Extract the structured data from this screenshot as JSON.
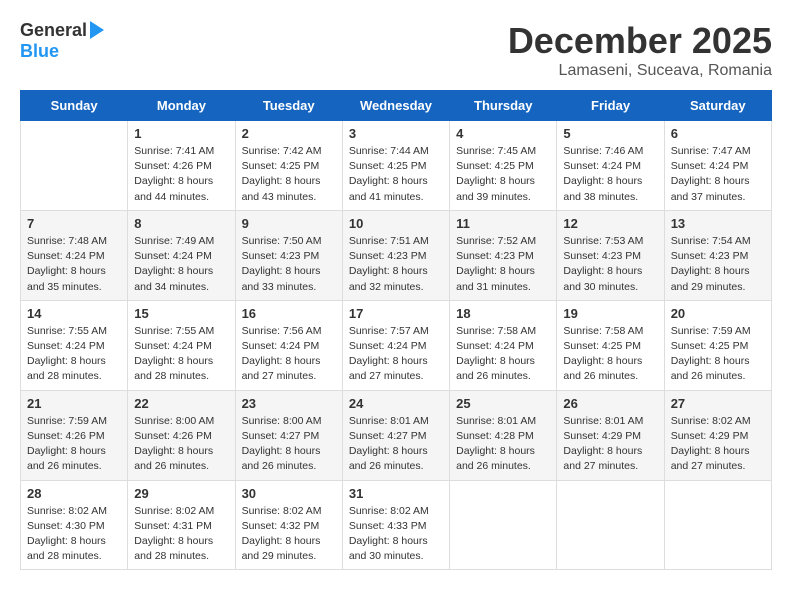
{
  "header": {
    "logo_general": "General",
    "logo_blue": "Blue",
    "month": "December 2025",
    "location": "Lamaseni, Suceava, Romania"
  },
  "days_of_week": [
    "Sunday",
    "Monday",
    "Tuesday",
    "Wednesday",
    "Thursday",
    "Friday",
    "Saturday"
  ],
  "weeks": [
    [
      {
        "day": null,
        "sunrise": null,
        "sunset": null,
        "daylight": null
      },
      {
        "day": "1",
        "sunrise": "7:41 AM",
        "sunset": "4:26 PM",
        "daylight": "8 hours and 44 minutes."
      },
      {
        "day": "2",
        "sunrise": "7:42 AM",
        "sunset": "4:25 PM",
        "daylight": "8 hours and 43 minutes."
      },
      {
        "day": "3",
        "sunrise": "7:44 AM",
        "sunset": "4:25 PM",
        "daylight": "8 hours and 41 minutes."
      },
      {
        "day": "4",
        "sunrise": "7:45 AM",
        "sunset": "4:25 PM",
        "daylight": "8 hours and 39 minutes."
      },
      {
        "day": "5",
        "sunrise": "7:46 AM",
        "sunset": "4:24 PM",
        "daylight": "8 hours and 38 minutes."
      },
      {
        "day": "6",
        "sunrise": "7:47 AM",
        "sunset": "4:24 PM",
        "daylight": "8 hours and 37 minutes."
      }
    ],
    [
      {
        "day": "7",
        "sunrise": "7:48 AM",
        "sunset": "4:24 PM",
        "daylight": "8 hours and 35 minutes."
      },
      {
        "day": "8",
        "sunrise": "7:49 AM",
        "sunset": "4:24 PM",
        "daylight": "8 hours and 34 minutes."
      },
      {
        "day": "9",
        "sunrise": "7:50 AM",
        "sunset": "4:23 PM",
        "daylight": "8 hours and 33 minutes."
      },
      {
        "day": "10",
        "sunrise": "7:51 AM",
        "sunset": "4:23 PM",
        "daylight": "8 hours and 32 minutes."
      },
      {
        "day": "11",
        "sunrise": "7:52 AM",
        "sunset": "4:23 PM",
        "daylight": "8 hours and 31 minutes."
      },
      {
        "day": "12",
        "sunrise": "7:53 AM",
        "sunset": "4:23 PM",
        "daylight": "8 hours and 30 minutes."
      },
      {
        "day": "13",
        "sunrise": "7:54 AM",
        "sunset": "4:23 PM",
        "daylight": "8 hours and 29 minutes."
      }
    ],
    [
      {
        "day": "14",
        "sunrise": "7:55 AM",
        "sunset": "4:24 PM",
        "daylight": "8 hours and 28 minutes."
      },
      {
        "day": "15",
        "sunrise": "7:55 AM",
        "sunset": "4:24 PM",
        "daylight": "8 hours and 28 minutes."
      },
      {
        "day": "16",
        "sunrise": "7:56 AM",
        "sunset": "4:24 PM",
        "daylight": "8 hours and 27 minutes."
      },
      {
        "day": "17",
        "sunrise": "7:57 AM",
        "sunset": "4:24 PM",
        "daylight": "8 hours and 27 minutes."
      },
      {
        "day": "18",
        "sunrise": "7:58 AM",
        "sunset": "4:24 PM",
        "daylight": "8 hours and 26 minutes."
      },
      {
        "day": "19",
        "sunrise": "7:58 AM",
        "sunset": "4:25 PM",
        "daylight": "8 hours and 26 minutes."
      },
      {
        "day": "20",
        "sunrise": "7:59 AM",
        "sunset": "4:25 PM",
        "daylight": "8 hours and 26 minutes."
      }
    ],
    [
      {
        "day": "21",
        "sunrise": "7:59 AM",
        "sunset": "4:26 PM",
        "daylight": "8 hours and 26 minutes."
      },
      {
        "day": "22",
        "sunrise": "8:00 AM",
        "sunset": "4:26 PM",
        "daylight": "8 hours and 26 minutes."
      },
      {
        "day": "23",
        "sunrise": "8:00 AM",
        "sunset": "4:27 PM",
        "daylight": "8 hours and 26 minutes."
      },
      {
        "day": "24",
        "sunrise": "8:01 AM",
        "sunset": "4:27 PM",
        "daylight": "8 hours and 26 minutes."
      },
      {
        "day": "25",
        "sunrise": "8:01 AM",
        "sunset": "4:28 PM",
        "daylight": "8 hours and 26 minutes."
      },
      {
        "day": "26",
        "sunrise": "8:01 AM",
        "sunset": "4:29 PM",
        "daylight": "8 hours and 27 minutes."
      },
      {
        "day": "27",
        "sunrise": "8:02 AM",
        "sunset": "4:29 PM",
        "daylight": "8 hours and 27 minutes."
      }
    ],
    [
      {
        "day": "28",
        "sunrise": "8:02 AM",
        "sunset": "4:30 PM",
        "daylight": "8 hours and 28 minutes."
      },
      {
        "day": "29",
        "sunrise": "8:02 AM",
        "sunset": "4:31 PM",
        "daylight": "8 hours and 28 minutes."
      },
      {
        "day": "30",
        "sunrise": "8:02 AM",
        "sunset": "4:32 PM",
        "daylight": "8 hours and 29 minutes."
      },
      {
        "day": "31",
        "sunrise": "8:02 AM",
        "sunset": "4:33 PM",
        "daylight": "8 hours and 30 minutes."
      },
      {
        "day": null,
        "sunrise": null,
        "sunset": null,
        "daylight": null
      },
      {
        "day": null,
        "sunrise": null,
        "sunset": null,
        "daylight": null
      },
      {
        "day": null,
        "sunrise": null,
        "sunset": null,
        "daylight": null
      }
    ]
  ],
  "labels": {
    "sunrise": "Sunrise:",
    "sunset": "Sunset:",
    "daylight": "Daylight:"
  }
}
